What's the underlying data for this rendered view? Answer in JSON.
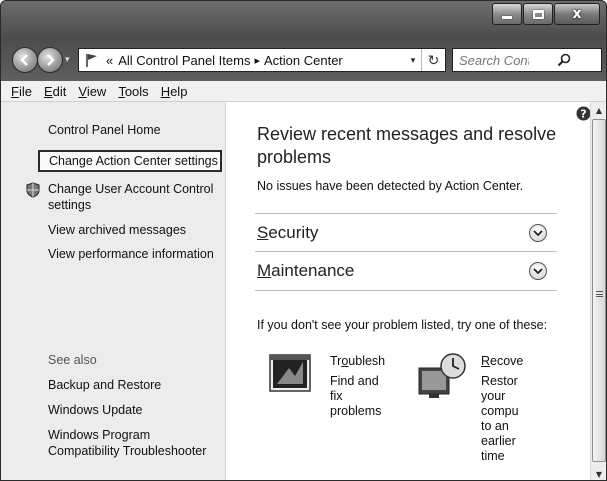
{
  "window": {
    "caption": {
      "min": "",
      "max": "",
      "close": "x"
    }
  },
  "address": {
    "overflow": "«",
    "crumbs": [
      "All Control Panel Items",
      "Action Center"
    ],
    "separator": "▸",
    "dropdown": "▾",
    "refresh": "↻"
  },
  "search": {
    "placeholder": "Search Control Pa..."
  },
  "menu": [
    {
      "label": "File",
      "accel": "F",
      "rest": "ile"
    },
    {
      "label": "Edit",
      "accel": "E",
      "rest": "dit"
    },
    {
      "label": "View",
      "accel": "V",
      "rest": "iew"
    },
    {
      "label": "Tools",
      "accel": "T",
      "rest": "ools"
    },
    {
      "label": "Help",
      "accel": "H",
      "rest": "elp"
    }
  ],
  "sidebar": {
    "home": "Control Panel Home",
    "change_settings": "Change Action Center settings",
    "uac_line1": "Change User Account Control",
    "uac_line2": "settings",
    "archived": "View archived messages",
    "performance": "View performance information",
    "see_also": "See also",
    "backup": "Backup and Restore",
    "windows_update": "Windows Update",
    "compat_line1": "Windows Program",
    "compat_line2": "Compatibility Troubleshooter"
  },
  "main": {
    "title": "Review recent messages and resolve problems",
    "status": "No issues have been detected by Action Center.",
    "security_accel": "S",
    "security_rest": "ecurity",
    "maintenance_accel": "M",
    "maintenance_rest": "aintenance",
    "try_text": "If you don't see your problem listed, try one of these:",
    "troubleshoot": {
      "title_pre": "Tr",
      "title_accel": "o",
      "title_rest": "ublesh",
      "desc": [
        "Find and",
        "fix",
        "problems"
      ]
    },
    "recovery": {
      "title_accel": "R",
      "title_rest": "ecove",
      "desc": [
        "Restor",
        "your",
        "compu",
        "to an",
        "earlier",
        "time"
      ]
    }
  },
  "icons": {
    "back": "back-arrow-icon",
    "forward": "forward-arrow-icon",
    "flag": "action-center-flag-icon",
    "search": "search-icon",
    "help": "help-icon",
    "shield": "uac-shield-icon",
    "chevron": "chevron-down-circle-icon",
    "troubleshoot": "troubleshooting-icon",
    "recovery": "recovery-icon"
  }
}
